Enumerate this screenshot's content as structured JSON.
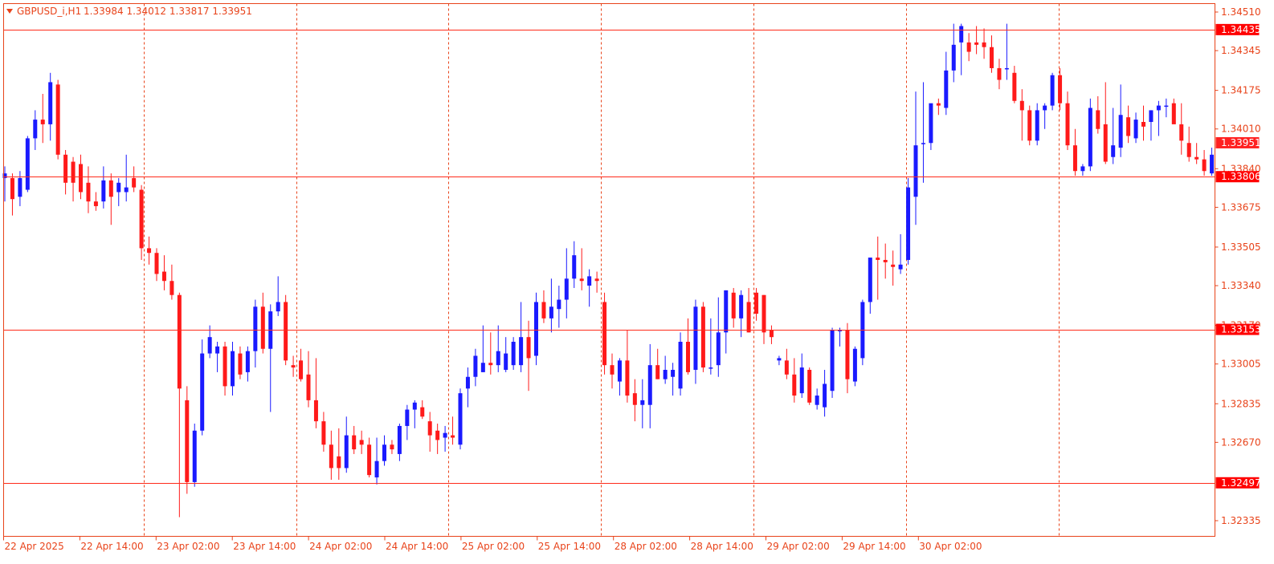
{
  "window": {
    "symbol_label": "GBPUSD_i,H1",
    "ohlc_label": "1.33984 1.34012 1.33817 1.33951",
    "menu_icon": "triangle-down-icon"
  },
  "colors": {
    "bull": "#1a1aff",
    "bear": "#ff1a1a",
    "frame": "#e8431a",
    "level_line": "#ff2a1a",
    "label_bg": "#ff0000",
    "bid_label_bg": "#ff2020"
  },
  "chart_data": {
    "type": "candlestick",
    "title": "GBPUSD_i,H1",
    "grid": "vertical dashed",
    "ylim": [
      1.3225,
      1.3454
    ],
    "y_ticks": [
      "1.34510",
      "1.34345",
      "1.34175",
      "1.34010",
      "1.33840",
      "1.33675",
      "1.33505",
      "1.33340",
      "1.33170",
      "1.33005",
      "1.32835",
      "1.32670",
      "1.32335"
    ],
    "x_ticks": [
      "22 Apr 2025",
      "22 Apr 14:00",
      "23 Apr 02:00",
      "23 Apr 14:00",
      "24 Apr 02:00",
      "24 Apr 14:00",
      "25 Apr 02:00",
      "25 Apr 14:00",
      "28 Apr 02:00",
      "28 Apr 14:00",
      "29 Apr 02:00",
      "29 Apr 14:00",
      "30 Apr 02:00"
    ],
    "horizontal_levels": [
      {
        "price": 1.34435,
        "label": "1.34435"
      },
      {
        "price": 1.33806,
        "label": "1.33806"
      },
      {
        "price": 1.33153,
        "label": "1.33153"
      },
      {
        "price": 1.32497,
        "label": "1.32497"
      }
    ],
    "bid": {
      "price": 1.33951,
      "label": "1.33951"
    },
    "candles": [
      {
        "o": 1.338,
        "h": 1.3385,
        "l": 1.337,
        "c": 1.3382
      },
      {
        "o": 1.338,
        "h": 1.3382,
        "l": 1.3364,
        "c": 1.3371
      },
      {
        "o": 1.3372,
        "h": 1.3383,
        "l": 1.3368,
        "c": 1.338
      },
      {
        "o": 1.3375,
        "h": 1.3398,
        "l": 1.3374,
        "c": 1.3397
      },
      {
        "o": 1.3397,
        "h": 1.3409,
        "l": 1.3392,
        "c": 1.3405
      },
      {
        "o": 1.3405,
        "h": 1.3416,
        "l": 1.3395,
        "c": 1.3403
      },
      {
        "o": 1.3403,
        "h": 1.3425,
        "l": 1.3396,
        "c": 1.3421
      },
      {
        "o": 1.342,
        "h": 1.3422,
        "l": 1.3388,
        "c": 1.339
      },
      {
        "o": 1.339,
        "h": 1.3392,
        "l": 1.3373,
        "c": 1.3378
      },
      {
        "o": 1.3387,
        "h": 1.3389,
        "l": 1.337,
        "c": 1.3378
      },
      {
        "o": 1.3386,
        "h": 1.339,
        "l": 1.3371,
        "c": 1.3374
      },
      {
        "o": 1.3378,
        "h": 1.3385,
        "l": 1.3365,
        "c": 1.337
      },
      {
        "o": 1.337,
        "h": 1.3374,
        "l": 1.3366,
        "c": 1.3368
      },
      {
        "o": 1.337,
        "h": 1.3385,
        "l": 1.3367,
        "c": 1.3379
      },
      {
        "o": 1.3379,
        "h": 1.3382,
        "l": 1.336,
        "c": 1.3372
      },
      {
        "o": 1.3374,
        "h": 1.338,
        "l": 1.3368,
        "c": 1.3378
      },
      {
        "o": 1.3374,
        "h": 1.339,
        "l": 1.337,
        "c": 1.3376
      },
      {
        "o": 1.338,
        "h": 1.3385,
        "l": 1.3374,
        "c": 1.3376
      },
      {
        "o": 1.3375,
        "h": 1.3377,
        "l": 1.3345,
        "c": 1.335
      },
      {
        "o": 1.335,
        "h": 1.3355,
        "l": 1.3343,
        "c": 1.3348
      },
      {
        "o": 1.3348,
        "h": 1.335,
        "l": 1.3336,
        "c": 1.3339
      },
      {
        "o": 1.334,
        "h": 1.3347,
        "l": 1.3332,
        "c": 1.3336
      },
      {
        "o": 1.3336,
        "h": 1.3343,
        "l": 1.3328,
        "c": 1.333
      },
      {
        "o": 1.333,
        "h": 1.3331,
        "l": 1.3235,
        "c": 1.329
      },
      {
        "o": 1.3285,
        "h": 1.3291,
        "l": 1.3245,
        "c": 1.325
      },
      {
        "o": 1.325,
        "h": 1.3275,
        "l": 1.3248,
        "c": 1.3272
      },
      {
        "o": 1.3272,
        "h": 1.3311,
        "l": 1.327,
        "c": 1.3305
      },
      {
        "o": 1.3305,
        "h": 1.3317,
        "l": 1.3303,
        "c": 1.3312
      },
      {
        "o": 1.3305,
        "h": 1.331,
        "l": 1.3297,
        "c": 1.3308
      },
      {
        "o": 1.3308,
        "h": 1.331,
        "l": 1.3287,
        "c": 1.3291
      },
      {
        "o": 1.3291,
        "h": 1.331,
        "l": 1.3287,
        "c": 1.3306
      },
      {
        "o": 1.3305,
        "h": 1.3308,
        "l": 1.3294,
        "c": 1.3296
      },
      {
        "o": 1.3297,
        "h": 1.3308,
        "l": 1.3293,
        "c": 1.3306
      },
      {
        "o": 1.3306,
        "h": 1.3328,
        "l": 1.3299,
        "c": 1.3325
      },
      {
        "o": 1.3325,
        "h": 1.3331,
        "l": 1.3305,
        "c": 1.3307
      },
      {
        "o": 1.3307,
        "h": 1.3326,
        "l": 1.328,
        "c": 1.3323
      },
      {
        "o": 1.3323,
        "h": 1.3338,
        "l": 1.3321,
        "c": 1.3327
      },
      {
        "o": 1.3327,
        "h": 1.333,
        "l": 1.33,
        "c": 1.3302
      },
      {
        "o": 1.33,
        "h": 1.3304,
        "l": 1.3295,
        "c": 1.3299
      },
      {
        "o": 1.3302,
        "h": 1.3307,
        "l": 1.3293,
        "c": 1.3294
      },
      {
        "o": 1.3296,
        "h": 1.3306,
        "l": 1.3282,
        "c": 1.3285
      },
      {
        "o": 1.3285,
        "h": 1.3303,
        "l": 1.3273,
        "c": 1.3276
      },
      {
        "o": 1.3276,
        "h": 1.328,
        "l": 1.3263,
        "c": 1.3266
      },
      {
        "o": 1.3266,
        "h": 1.3272,
        "l": 1.3251,
        "c": 1.3256
      },
      {
        "o": 1.3261,
        "h": 1.3273,
        "l": 1.3251,
        "c": 1.3256
      },
      {
        "o": 1.3256,
        "h": 1.3278,
        "l": 1.3254,
        "c": 1.327
      },
      {
        "o": 1.327,
        "h": 1.3274,
        "l": 1.3262,
        "c": 1.3264
      },
      {
        "o": 1.3268,
        "h": 1.3272,
        "l": 1.3262,
        "c": 1.3266
      },
      {
        "o": 1.3266,
        "h": 1.3269,
        "l": 1.3252,
        "c": 1.3253
      },
      {
        "o": 1.3252,
        "h": 1.3269,
        "l": 1.3249,
        "c": 1.3259
      },
      {
        "o": 1.3259,
        "h": 1.327,
        "l": 1.3257,
        "c": 1.3266
      },
      {
        "o": 1.3266,
        "h": 1.3268,
        "l": 1.3262,
        "c": 1.3264
      },
      {
        "o": 1.3262,
        "h": 1.3275,
        "l": 1.3259,
        "c": 1.3274
      },
      {
        "o": 1.3274,
        "h": 1.3283,
        "l": 1.3268,
        "c": 1.3281
      },
      {
        "o": 1.3281,
        "h": 1.3285,
        "l": 1.3273,
        "c": 1.3284
      },
      {
        "o": 1.3282,
        "h": 1.3285,
        "l": 1.3277,
        "c": 1.3278
      },
      {
        "o": 1.3276,
        "h": 1.328,
        "l": 1.3263,
        "c": 1.327
      },
      {
        "o": 1.3272,
        "h": 1.3275,
        "l": 1.3262,
        "c": 1.3268
      },
      {
        "o": 1.3269,
        "h": 1.3274,
        "l": 1.3263,
        "c": 1.3271
      },
      {
        "o": 1.327,
        "h": 1.3278,
        "l": 1.3266,
        "c": 1.3269
      },
      {
        "o": 1.3266,
        "h": 1.329,
        "l": 1.3264,
        "c": 1.3288
      },
      {
        "o": 1.329,
        "h": 1.3299,
        "l": 1.3282,
        "c": 1.3295
      },
      {
        "o": 1.3295,
        "h": 1.3307,
        "l": 1.3291,
        "c": 1.3304
      },
      {
        "o": 1.3297,
        "h": 1.3317,
        "l": 1.3297,
        "c": 1.3301
      },
      {
        "o": 1.3301,
        "h": 1.3314,
        "l": 1.3296,
        "c": 1.33
      },
      {
        "o": 1.33,
        "h": 1.3317,
        "l": 1.3297,
        "c": 1.3306
      },
      {
        "o": 1.3298,
        "h": 1.3312,
        "l": 1.3297,
        "c": 1.3305
      },
      {
        "o": 1.33,
        "h": 1.3312,
        "l": 1.3298,
        "c": 1.331
      },
      {
        "o": 1.33,
        "h": 1.3327,
        "l": 1.3297,
        "c": 1.3312
      },
      {
        "o": 1.3312,
        "h": 1.3319,
        "l": 1.3289,
        "c": 1.3303
      },
      {
        "o": 1.3304,
        "h": 1.3331,
        "l": 1.33,
        "c": 1.3327
      },
      {
        "o": 1.3327,
        "h": 1.3332,
        "l": 1.3318,
        "c": 1.332
      },
      {
        "o": 1.332,
        "h": 1.3337,
        "l": 1.3314,
        "c": 1.3325
      },
      {
        "o": 1.3324,
        "h": 1.3334,
        "l": 1.3316,
        "c": 1.3328
      },
      {
        "o": 1.3328,
        "h": 1.335,
        "l": 1.332,
        "c": 1.3337
      },
      {
        "o": 1.3337,
        "h": 1.3353,
        "l": 1.3333,
        "c": 1.3347
      },
      {
        "o": 1.3337,
        "h": 1.335,
        "l": 1.3332,
        "c": 1.3336
      },
      {
        "o": 1.3334,
        "h": 1.3341,
        "l": 1.3325,
        "c": 1.3338
      },
      {
        "o": 1.3337,
        "h": 1.334,
        "l": 1.3331,
        "c": 1.3336
      },
      {
        "o": 1.3327,
        "h": 1.3331,
        "l": 1.3296,
        "c": 1.33
      },
      {
        "o": 1.33,
        "h": 1.3305,
        "l": 1.329,
        "c": 1.3296
      },
      {
        "o": 1.3293,
        "h": 1.3303,
        "l": 1.3287,
        "c": 1.3302
      },
      {
        "o": 1.3302,
        "h": 1.3315,
        "l": 1.3284,
        "c": 1.3287
      },
      {
        "o": 1.3288,
        "h": 1.3294,
        "l": 1.3276,
        "c": 1.3283
      },
      {
        "o": 1.3283,
        "h": 1.3294,
        "l": 1.3273,
        "c": 1.3285
      },
      {
        "o": 1.3283,
        "h": 1.3309,
        "l": 1.3273,
        "c": 1.33
      },
      {
        "o": 1.33,
        "h": 1.3307,
        "l": 1.3294,
        "c": 1.3294
      },
      {
        "o": 1.3294,
        "h": 1.3304,
        "l": 1.3292,
        "c": 1.3298
      },
      {
        "o": 1.3295,
        "h": 1.3301,
        "l": 1.3287,
        "c": 1.3298
      },
      {
        "o": 1.329,
        "h": 1.3314,
        "l": 1.3287,
        "c": 1.331
      },
      {
        "o": 1.331,
        "h": 1.332,
        "l": 1.3296,
        "c": 1.3297
      },
      {
        "o": 1.3298,
        "h": 1.3328,
        "l": 1.3292,
        "c": 1.3325
      },
      {
        "o": 1.3325,
        "h": 1.3327,
        "l": 1.3297,
        "c": 1.3299
      },
      {
        "o": 1.3299,
        "h": 1.332,
        "l": 1.3296,
        "c": 1.3299
      },
      {
        "o": 1.33,
        "h": 1.3329,
        "l": 1.3295,
        "c": 1.3314
      },
      {
        "o": 1.3314,
        "h": 1.3332,
        "l": 1.3305,
        "c": 1.3332
      },
      {
        "o": 1.3331,
        "h": 1.3333,
        "l": 1.3316,
        "c": 1.332
      },
      {
        "o": 1.332,
        "h": 1.3332,
        "l": 1.3312,
        "c": 1.333
      },
      {
        "o": 1.3327,
        "h": 1.3333,
        "l": 1.3314,
        "c": 1.3314
      },
      {
        "o": 1.3331,
        "h": 1.3333,
        "l": 1.3319,
        "c": 1.3322
      },
      {
        "o": 1.333,
        "h": 1.333,
        "l": 1.3309,
        "c": 1.3314
      },
      {
        "o": 1.3315,
        "h": 1.3317,
        "l": 1.3309,
        "c": 1.3312
      },
      {
        "o": 1.3302,
        "h": 1.3304,
        "l": 1.33,
        "c": 1.3303
      },
      {
        "o": 1.3302,
        "h": 1.3307,
        "l": 1.3294,
        "c": 1.3296
      },
      {
        "o": 1.3296,
        "h": 1.3303,
        "l": 1.3284,
        "c": 1.3287
      },
      {
        "o": 1.3288,
        "h": 1.3305,
        "l": 1.3286,
        "c": 1.3299
      },
      {
        "o": 1.3298,
        "h": 1.3299,
        "l": 1.3283,
        "c": 1.3284
      },
      {
        "o": 1.3283,
        "h": 1.329,
        "l": 1.3281,
        "c": 1.3287
      },
      {
        "o": 1.3282,
        "h": 1.3298,
        "l": 1.3278,
        "c": 1.3292
      },
      {
        "o": 1.3289,
        "h": 1.3316,
        "l": 1.3286,
        "c": 1.3315
      },
      {
        "o": 1.3315,
        "h": 1.3316,
        "l": 1.3308,
        "c": 1.3315
      },
      {
        "o": 1.3315,
        "h": 1.3318,
        "l": 1.3288,
        "c": 1.3294
      },
      {
        "o": 1.3293,
        "h": 1.3308,
        "l": 1.3291,
        "c": 1.3307
      },
      {
        "o": 1.3303,
        "h": 1.3328,
        "l": 1.33,
        "c": 1.3327
      },
      {
        "o": 1.3327,
        "h": 1.3342,
        "l": 1.3322,
        "c": 1.3346
      },
      {
        "o": 1.3346,
        "h": 1.3355,
        "l": 1.3328,
        "c": 1.3345
      },
      {
        "o": 1.3345,
        "h": 1.3352,
        "l": 1.3337,
        "c": 1.3344
      },
      {
        "o": 1.3343,
        "h": 1.3349,
        "l": 1.3334,
        "c": 1.3342
      },
      {
        "o": 1.3341,
        "h": 1.3356,
        "l": 1.3339,
        "c": 1.3343
      },
      {
        "o": 1.3345,
        "h": 1.338,
        "l": 1.3343,
        "c": 1.3376
      },
      {
        "o": 1.3372,
        "h": 1.3417,
        "l": 1.336,
        "c": 1.3394
      },
      {
        "o": 1.3395,
        "h": 1.3421,
        "l": 1.3378,
        "c": 1.3395
      },
      {
        "o": 1.3395,
        "h": 1.3411,
        "l": 1.3392,
        "c": 1.3412
      },
      {
        "o": 1.3412,
        "h": 1.3414,
        "l": 1.3407,
        "c": 1.3411
      },
      {
        "o": 1.341,
        "h": 1.3434,
        "l": 1.3407,
        "c": 1.3426
      },
      {
        "o": 1.3426,
        "h": 1.3446,
        "l": 1.3421,
        "c": 1.3437
      },
      {
        "o": 1.3438,
        "h": 1.3446,
        "l": 1.3424,
        "c": 1.3445
      },
      {
        "o": 1.3438,
        "h": 1.3442,
        "l": 1.343,
        "c": 1.3434
      },
      {
        "o": 1.3438,
        "h": 1.3445,
        "l": 1.3433,
        "c": 1.3437
      },
      {
        "o": 1.3438,
        "h": 1.3444,
        "l": 1.3431,
        "c": 1.3436
      },
      {
        "o": 1.3436,
        "h": 1.3441,
        "l": 1.3425,
        "c": 1.3427
      },
      {
        "o": 1.3427,
        "h": 1.3431,
        "l": 1.3418,
        "c": 1.3422
      },
      {
        "o": 1.3427,
        "h": 1.3446,
        "l": 1.3422,
        "c": 1.3427
      },
      {
        "o": 1.3425,
        "h": 1.3428,
        "l": 1.3412,
        "c": 1.3413
      },
      {
        "o": 1.3413,
        "h": 1.3418,
        "l": 1.3396,
        "c": 1.3409
      },
      {
        "o": 1.3409,
        "h": 1.3411,
        "l": 1.3394,
        "c": 1.3396
      },
      {
        "o": 1.3396,
        "h": 1.3412,
        "l": 1.3394,
        "c": 1.3409
      },
      {
        "o": 1.3409,
        "h": 1.3412,
        "l": 1.3401,
        "c": 1.3411
      },
      {
        "o": 1.3411,
        "h": 1.3425,
        "l": 1.3409,
        "c": 1.3424
      },
      {
        "o": 1.3424,
        "h": 1.3427,
        "l": 1.3409,
        "c": 1.3412
      },
      {
        "o": 1.3412,
        "h": 1.3417,
        "l": 1.3392,
        "c": 1.3394
      },
      {
        "o": 1.3394,
        "h": 1.3401,
        "l": 1.3381,
        "c": 1.3383
      },
      {
        "o": 1.3383,
        "h": 1.3386,
        "l": 1.3381,
        "c": 1.3385
      },
      {
        "o": 1.3385,
        "h": 1.3414,
        "l": 1.3383,
        "c": 1.341
      },
      {
        "o": 1.3409,
        "h": 1.3415,
        "l": 1.3399,
        "c": 1.3401
      },
      {
        "o": 1.3403,
        "h": 1.3421,
        "l": 1.3386,
        "c": 1.3387
      },
      {
        "o": 1.3389,
        "h": 1.341,
        "l": 1.3386,
        "c": 1.3394
      },
      {
        "o": 1.3393,
        "h": 1.342,
        "l": 1.3389,
        "c": 1.3407
      },
      {
        "o": 1.3406,
        "h": 1.3411,
        "l": 1.3395,
        "c": 1.3398
      },
      {
        "o": 1.3397,
        "h": 1.3408,
        "l": 1.3395,
        "c": 1.3405
      },
      {
        "o": 1.3404,
        "h": 1.3411,
        "l": 1.3396,
        "c": 1.3402
      },
      {
        "o": 1.3404,
        "h": 1.3409,
        "l": 1.3396,
        "c": 1.3409
      },
      {
        "o": 1.3409,
        "h": 1.3413,
        "l": 1.3398,
        "c": 1.3411
      },
      {
        "o": 1.3411,
        "h": 1.3414,
        "l": 1.3406,
        "c": 1.3411
      },
      {
        "o": 1.3412,
        "h": 1.3414,
        "l": 1.3404,
        "c": 1.3403
      },
      {
        "o": 1.3403,
        "h": 1.3412,
        "l": 1.339,
        "c": 1.3396
      },
      {
        "o": 1.3395,
        "h": 1.3402,
        "l": 1.3387,
        "c": 1.3389
      },
      {
        "o": 1.3389,
        "h": 1.3395,
        "l": 1.3386,
        "c": 1.3388
      },
      {
        "o": 1.3388,
        "h": 1.3392,
        "l": 1.3381,
        "c": 1.3383
      },
      {
        "o": 1.3382,
        "h": 1.3393,
        "l": 1.3381,
        "c": 1.339
      },
      {
        "o": 1.3389,
        "h": 1.3402,
        "l": 1.3387,
        "c": 1.3398
      },
      {
        "o": 1.3398,
        "h": 1.3401,
        "l": 1.3382,
        "c": 1.3395
      }
    ]
  }
}
